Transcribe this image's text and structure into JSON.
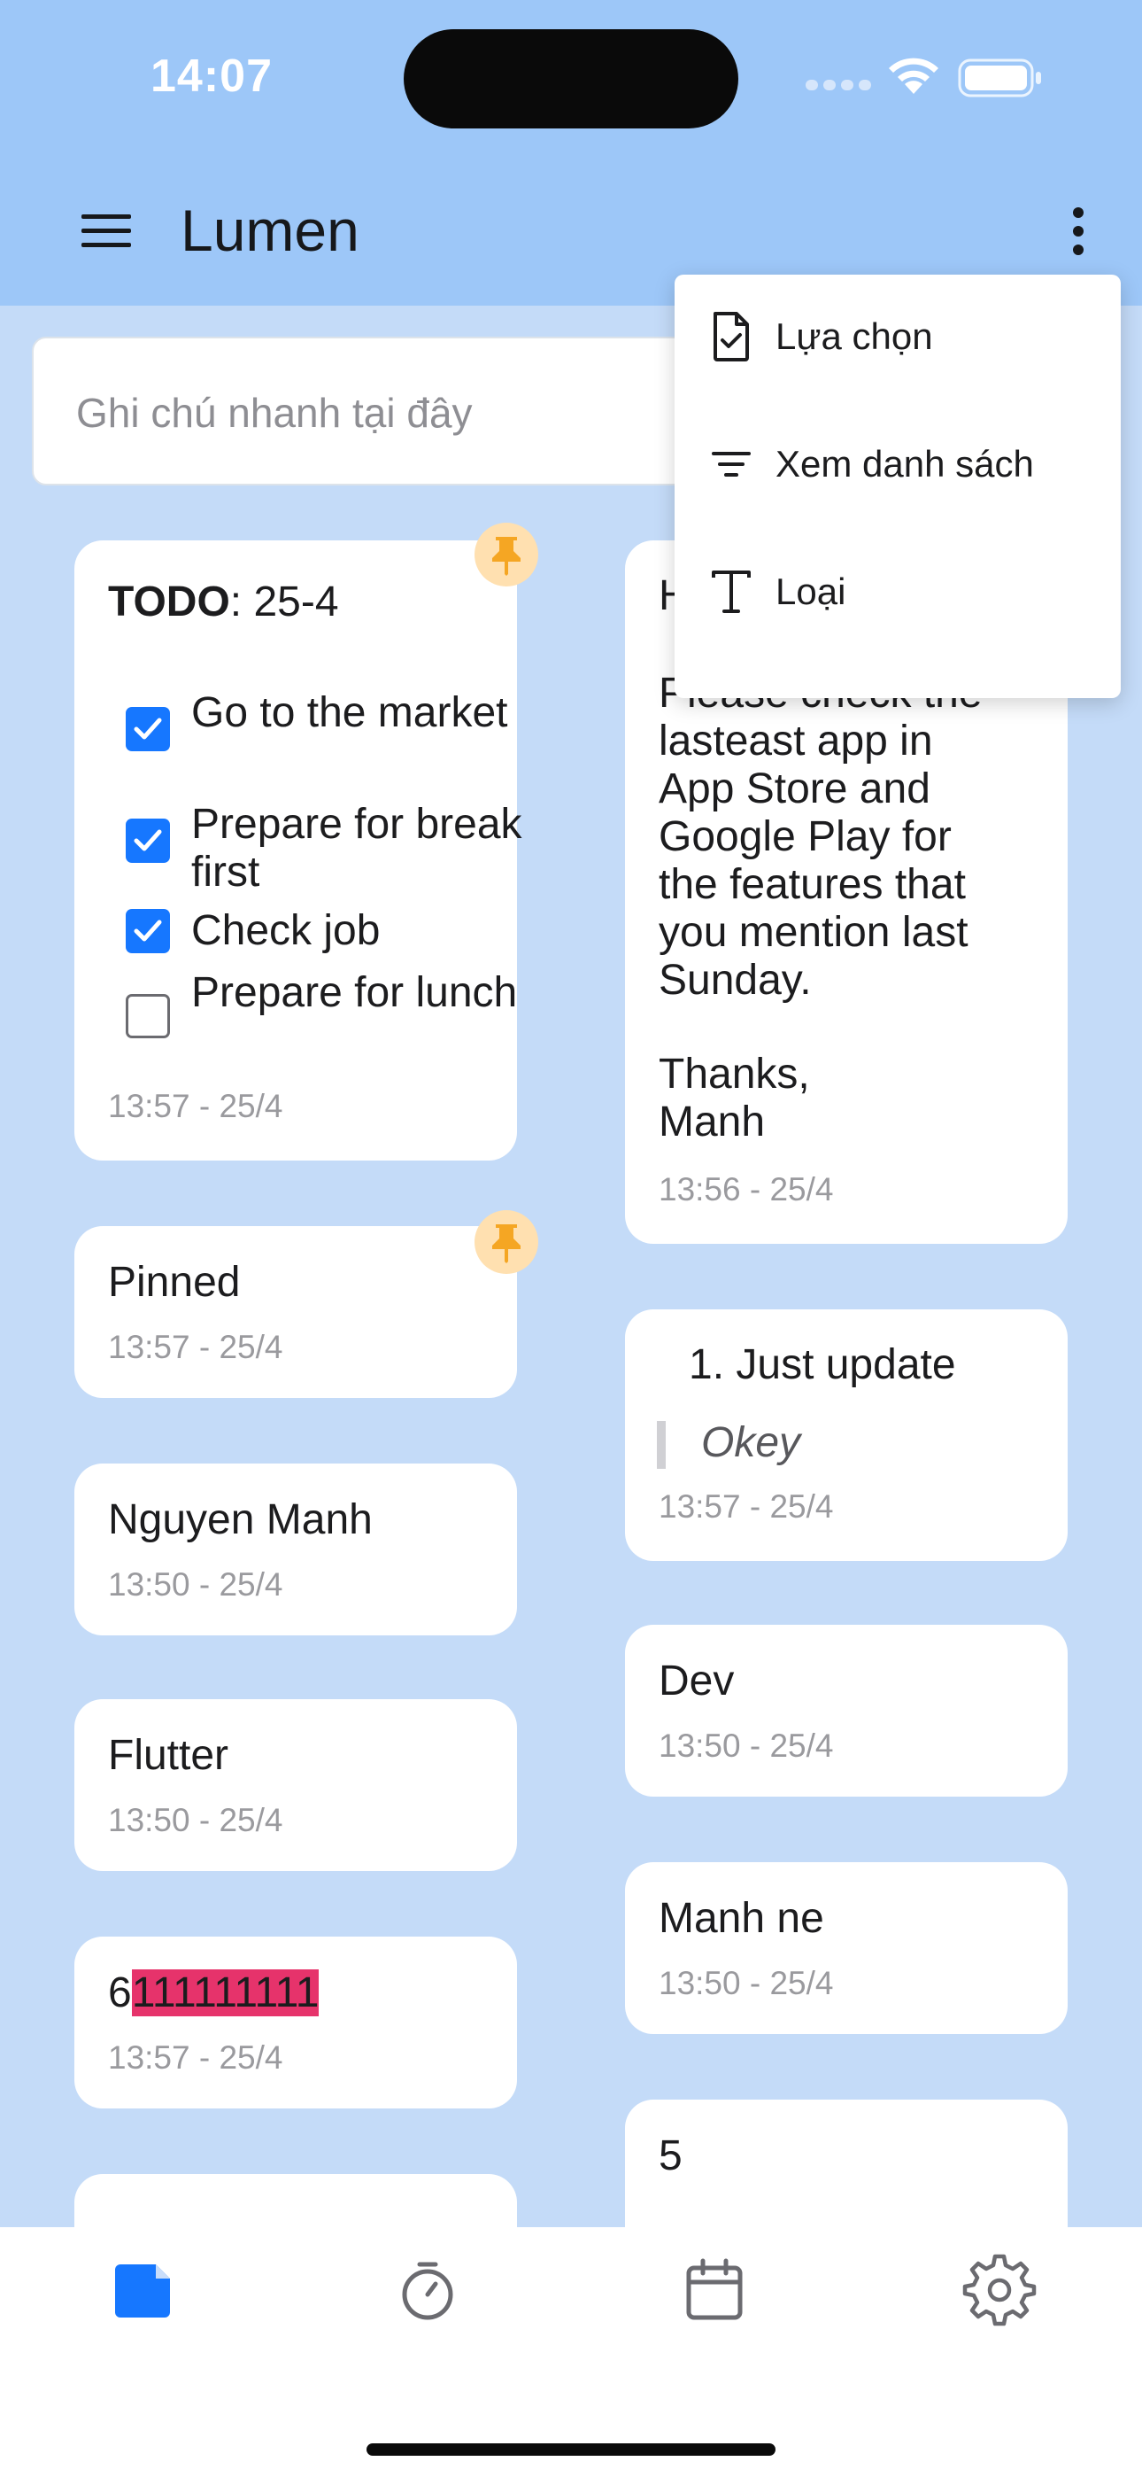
{
  "status_bar": {
    "time": "14:07"
  },
  "app": {
    "title": "Lumen"
  },
  "quick_note": {
    "placeholder": "Ghi chú nhanh tại đây"
  },
  "dropdown_menu": {
    "items": [
      {
        "label": "Lựa chọn",
        "icon": "file-check-icon"
      },
      {
        "label": "Xem danh sách",
        "icon": "filter-lines-icon"
      },
      {
        "label": "Loại",
        "icon": "text-type-icon"
      }
    ]
  },
  "notes_left": [
    {
      "type": "todo",
      "title_bold": "TODO",
      "title_rest": ": 25-4",
      "pinned": true,
      "items": [
        {
          "label": "Go to the market",
          "checked": true
        },
        {
          "label": "Prepare for break first",
          "checked": true
        },
        {
          "label": "Check job",
          "checked": true
        },
        {
          "label": "Prepare for lunch",
          "checked": false
        }
      ],
      "time": "13:57 - 25/4"
    },
    {
      "title": "Pinned",
      "time": "13:57 - 25/4",
      "pinned": true
    },
    {
      "title": "Nguyen Manh",
      "time": "13:50 - 25/4"
    },
    {
      "title": "Flutter",
      "time": "13:50 - 25/4"
    },
    {
      "title_prefix": "6",
      "title_highlight": "111111111",
      "time": "13:57 - 25/4"
    }
  ],
  "notes_right": [
    {
      "first_line": "H",
      "body_lines": [
        "Please check the",
        "lasteast app in",
        "App Store and",
        "Google Play for",
        "the features that",
        "you mention last",
        "Sunday."
      ],
      "signoff_lines": [
        "Thanks,",
        "Manh"
      ],
      "time": "13:56 - 25/4"
    },
    {
      "list_item": "1.  Just update",
      "quote": "Okey",
      "time": "13:57 - 25/4"
    },
    {
      "title": "Dev",
      "time": "13:50 - 25/4"
    },
    {
      "title": "Manh ne",
      "time": "13:50 - 25/4"
    },
    {
      "title": "5"
    }
  ],
  "bottom_nav": [
    {
      "icon": "note-icon",
      "active": true
    },
    {
      "icon": "timer-icon",
      "active": false
    },
    {
      "icon": "calendar-icon",
      "active": false
    },
    {
      "icon": "gear-icon",
      "active": false
    }
  ],
  "colors": {
    "header": "#9dc7f8",
    "background": "#c4dbf8",
    "accent": "#1677ff",
    "pin_bg": "#ffe0b0",
    "pin": "#f5a623",
    "highlight": "#e6336b"
  }
}
